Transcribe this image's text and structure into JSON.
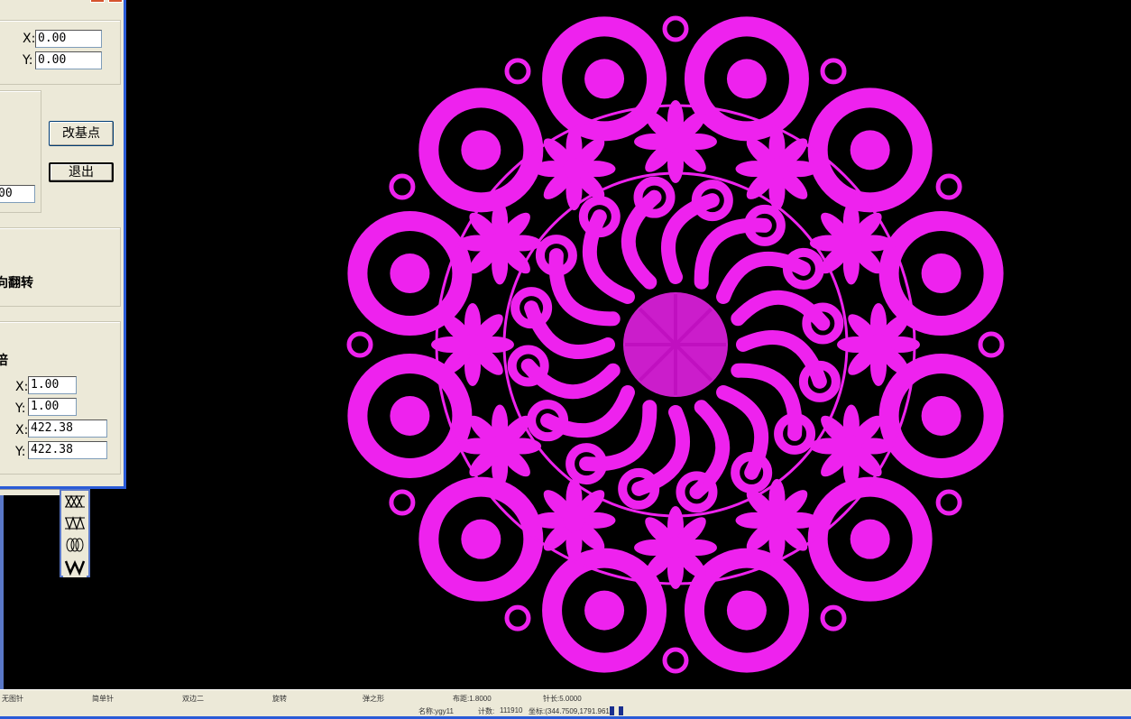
{
  "base_point": {
    "x_label": "X:",
    "x_value": "0.00",
    "y_label": "Y:",
    "y_value": "0.00"
  },
  "buttons": {
    "change_base": "改基点",
    "exit": "退出"
  },
  "middle_group": {
    "value_partial": "00"
  },
  "flip_group": {
    "label_partial": "向翻转"
  },
  "scale_group": {
    "label_partial": "倍",
    "sx_label": "X:",
    "sx_value": "1.00",
    "sy_label": "Y:",
    "sy_value": "1.00",
    "wx_label": "X:",
    "wx_value": "422.38",
    "wy_label": "Y:",
    "wy_value": "422.38"
  },
  "toolbar": {
    "icons": [
      "cross-stitch-icon",
      "zigzag-stitch-icon",
      "loop-stitch-icon",
      "w-stitch-icon"
    ]
  },
  "design": {
    "color": "#ee22ee",
    "background": "#000000"
  },
  "statusbar": {
    "row1": [
      "无图针",
      "简单针",
      "双边二",
      "旋转",
      "弹之形"
    ],
    "spacing": "布距:1.8000",
    "needle_length": "针长:5.0000",
    "name": "名称:ygy11",
    "count_label": "计数:",
    "count": "111910",
    "coords": "坐标:(344.7509,1791.961)"
  }
}
